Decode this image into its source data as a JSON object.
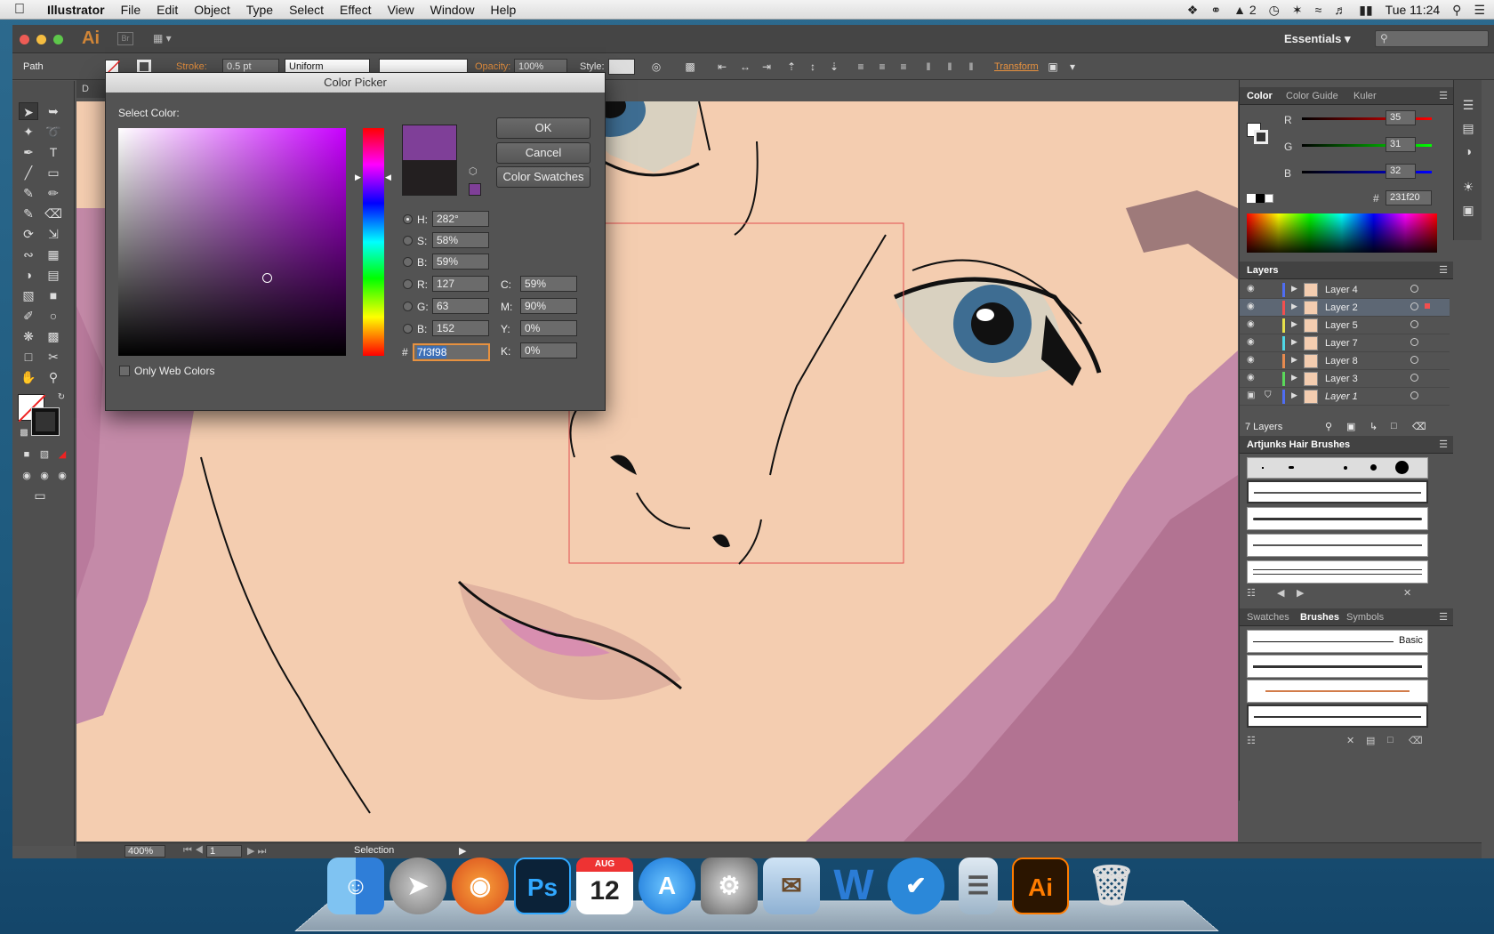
{
  "menubar": {
    "app_name": "Illustrator",
    "items": [
      "File",
      "Edit",
      "Object",
      "Type",
      "Select",
      "Effect",
      "View",
      "Window",
      "Help"
    ],
    "adobe_badge": "2",
    "clock": "Tue 11:24"
  },
  "titlebar": {
    "app_badge": "Ai",
    "bridge_badge": "Br",
    "workspace": "Essentials",
    "search_placeholder": ""
  },
  "controlbar": {
    "selection_type": "Path",
    "stroke_label": "Stroke:",
    "stroke_weight": "0.5 pt",
    "stroke_profile": "Uniform",
    "opacity_label": "Opacity:",
    "opacity_value": "100%",
    "style_label": "Style:",
    "transform_label": "Transform"
  },
  "document_tab": "D",
  "statusbar": {
    "zoom": "400%",
    "artboard": "1",
    "status_text": "Selection"
  },
  "color_picker": {
    "title": "Color Picker",
    "select_label": "Select Color:",
    "buttons": {
      "ok": "OK",
      "cancel": "Cancel",
      "swatches": "Color Swatches"
    },
    "new_color": "#7f3f98",
    "old_color": "#231f20",
    "hsb": {
      "h_label": "H:",
      "h": "282°",
      "s_label": "S:",
      "s": "58%",
      "b_label": "B:",
      "b": "59%"
    },
    "rgb": {
      "r_label": "R:",
      "r": "127",
      "g_label": "G:",
      "g": "63",
      "b_label": "B:",
      "b": "152"
    },
    "cmyk": {
      "c_label": "C:",
      "c": "59%",
      "m_label": "M:",
      "m": "90%",
      "y_label": "Y:",
      "y": "0%",
      "k_label": "K:",
      "k": "0%"
    },
    "hex_prefix": "#",
    "hex": "7f3f98",
    "only_web_colors": "Only Web Colors"
  },
  "color_panel": {
    "tabs": [
      "Color",
      "Color Guide",
      "Kuler"
    ],
    "r_label": "R",
    "r": "35",
    "g_label": "G",
    "g": "31",
    "b_label": "B",
    "b": "32",
    "hex_prefix": "#",
    "hex": "231f20"
  },
  "layers_panel": {
    "title": "Layers",
    "layers": [
      {
        "name": "Layer 4",
        "color": "#4f6df2",
        "selected": false
      },
      {
        "name": "Layer 2",
        "color": "#f24f4f",
        "selected": true
      },
      {
        "name": "Layer 5",
        "color": "#e6e04a",
        "selected": false
      },
      {
        "name": "Layer 7",
        "color": "#4fd8e6",
        "selected": false
      },
      {
        "name": "Layer 8",
        "color": "#e68a4f",
        "selected": false
      },
      {
        "name": "Layer 3",
        "color": "#5ad85a",
        "selected": false
      },
      {
        "name": "Layer 1",
        "color": "#4f6df2",
        "selected": false
      }
    ],
    "count": "7 Layers"
  },
  "hair_brushes_panel": {
    "title": "Artjunks Hair Brushes"
  },
  "brushes_panel": {
    "tabs": [
      "Swatches",
      "Brushes",
      "Symbols"
    ],
    "basic_label": "Basic"
  },
  "dock": {
    "apps": [
      "Finder",
      "Launchpad",
      "Firefox",
      "Photoshop",
      "Calendar",
      "App Store",
      "System Preferences",
      "Mail",
      "Word",
      "Wunderlist",
      "Archive Utility",
      "Illustrator",
      "Trash"
    ],
    "calendar_month": "AUG",
    "calendar_day": "12",
    "ps_label": "Ps",
    "ai_label": "Ai"
  },
  "colors": {
    "accent_orange": "#e7913f",
    "skin": "#f4cdb0",
    "hair": "#c48aa8",
    "eye": "#3e6d92"
  }
}
